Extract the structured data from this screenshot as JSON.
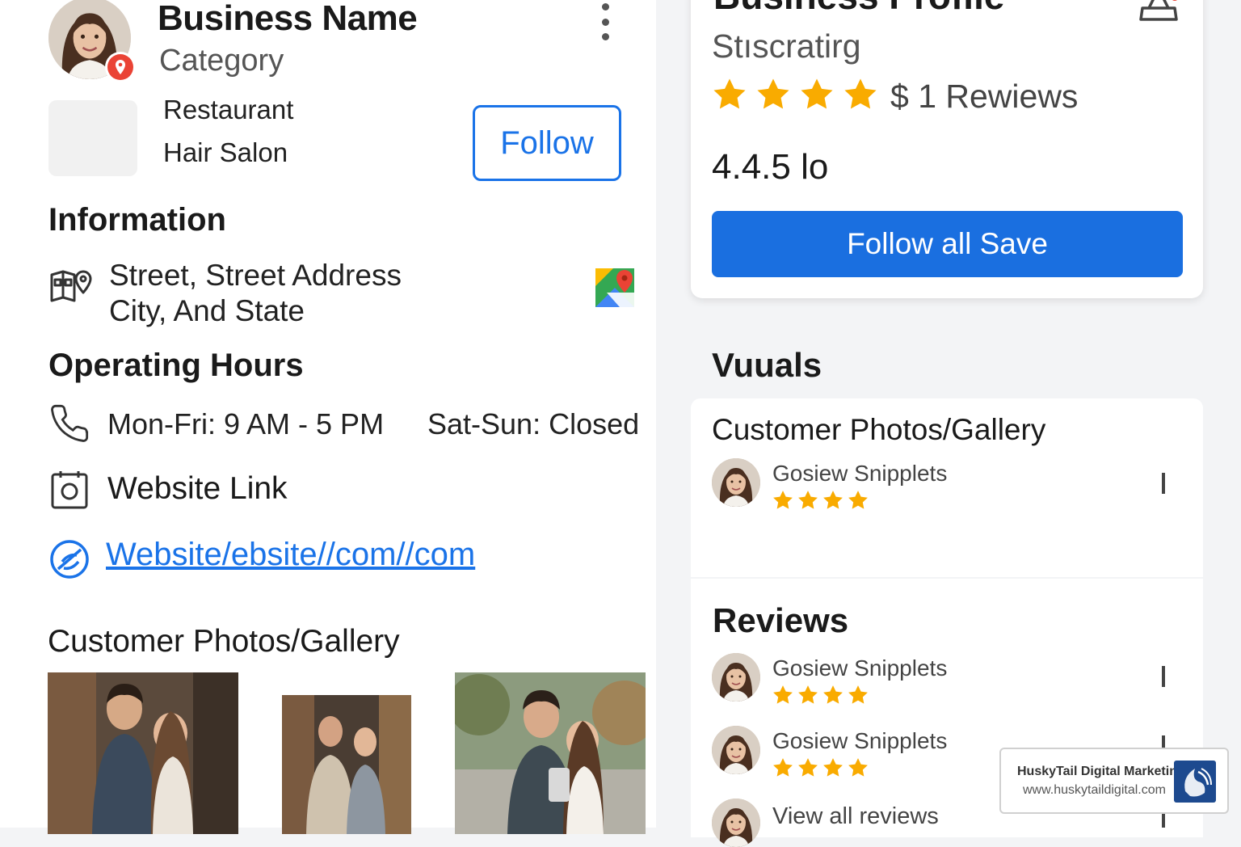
{
  "business": {
    "name": "Business Name",
    "category": "Category",
    "categories": [
      "Restaurant",
      "Hair Salon"
    ],
    "follow_label": "Follow"
  },
  "information": {
    "title": "Information",
    "address_line1": "Street, Street Address",
    "address_line2": "City, And State"
  },
  "hours": {
    "title": "Operating Hours",
    "weekdays": "Mon-Fri: 9 AM - 5 PM",
    "weekend": "Sat-Sun: Closed"
  },
  "website": {
    "label": "Website Link",
    "url": "Website/ebsite//com//com"
  },
  "gallery": {
    "title": "Customer Photos/Gallery"
  },
  "profile": {
    "title": "Business Profile",
    "subtitle": "Stıscratirg",
    "stars": 4,
    "review_count": "$ 1 Rewiews",
    "rating": "4.4.5 lo",
    "save_label": "Follow all  Save"
  },
  "visuals": {
    "title": "Vuuals",
    "gallery_card_title": "Customer Photos/Gallery",
    "gallery_reviewer": {
      "name": "Gosiew Snipplets",
      "stars": 4
    }
  },
  "reviews": {
    "title": "Reviews",
    "items": [
      {
        "name": "Gosiew Snipplets",
        "stars": 4
      },
      {
        "name": "Gosiew Snipplets",
        "stars": 4
      }
    ],
    "view_all_label": "View all reviews"
  },
  "watermark": {
    "name": "HuskyTail Digital Marketing",
    "url": "www.huskytaildigital.com"
  },
  "colors": {
    "accent": "#1a73e8",
    "button_blue": "#1a6fe0",
    "star": "#f9ab00",
    "pin_red": "#ea4335"
  }
}
